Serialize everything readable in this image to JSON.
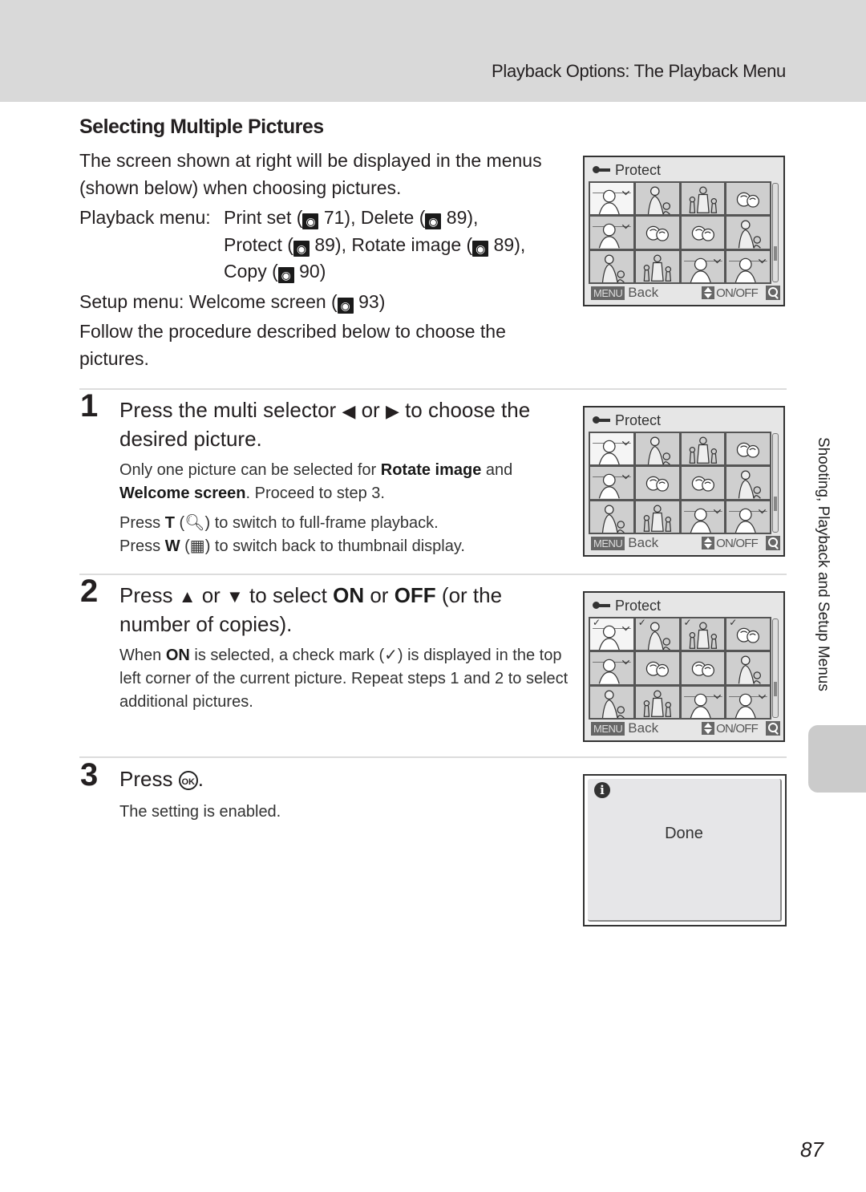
{
  "header": {
    "title": "Playback Options: The Playback Menu"
  },
  "section": {
    "title": "Selecting Multiple Pictures"
  },
  "intro": {
    "para1": "The screen shown at right will be displayed in the menus (shown below) when choosing pictures.",
    "playback_label": "Playback menu:",
    "playback_items": [
      {
        "name": "Print set (",
        "page": "71",
        "suffix": "), "
      },
      {
        "name": "Delete (",
        "page": "89",
        "suffix": "),"
      },
      {
        "name": "Protect (",
        "page": "89",
        "suffix": "), "
      },
      {
        "name": "Rotate image (",
        "page": "89",
        "suffix": "),"
      },
      {
        "name": "Copy (",
        "page": "90",
        "suffix": ")"
      }
    ],
    "setup_label": "Setup menu: Welcome screen (",
    "setup_page": "93",
    "setup_suffix": ")",
    "para_follow": "Follow the procedure described below to choose the pictures.",
    "ref_icon": "page-reference-icon"
  },
  "steps": [
    {
      "number": "1",
      "head_pre": "Press the multi selector ",
      "head_mid": " or ",
      "head_post": " to choose the desired picture.",
      "left_glyph": "◀",
      "right_glyph": "▶",
      "body1_pre": "Only one picture can be selected for ",
      "body1_b1": "Rotate image",
      "body1_mid": " and ",
      "body1_b2": "Welcome screen",
      "body1_post": ". Proceed to step 3.",
      "body2_pre": "Press ",
      "body2_key": "T",
      "body2_post": " to switch to full-frame playback.",
      "body3_pre": "Press ",
      "body3_key": "W",
      "body3_post": " to switch back to thumbnail display."
    },
    {
      "number": "2",
      "head_pre": "Press ",
      "up_glyph": "▲",
      "head_or": " or ",
      "down_glyph": "▼",
      "head_mid": " to select ",
      "on": "ON",
      "or2": " or ",
      "off": "OFF",
      "head_post": " (or the number of copies).",
      "body_pre": "When ",
      "body_on": "ON",
      "body_post": " is selected, a check mark (✓) is displayed in the top left corner of the current picture. Repeat steps 1 and 2 to select additional pictures."
    },
    {
      "number": "3",
      "head_pre": "Press ",
      "ok_glyph": "OK",
      "head_post": ".",
      "body": "The setting is enabled."
    }
  ],
  "camera_screens": [
    {
      "title": "Protect",
      "back": "Back",
      "menu": "MENU",
      "onoff": "ON/OFF",
      "checked": []
    },
    {
      "title": "Protect",
      "back": "Back",
      "menu": "MENU",
      "onoff": "ON/OFF",
      "checked": []
    },
    {
      "title": "Protect",
      "back": "Back",
      "menu": "MENU",
      "onoff": "ON/OFF",
      "checked": [
        0,
        1,
        2,
        3
      ]
    }
  ],
  "done_screen": {
    "text": "Done"
  },
  "side_tab": {
    "text": "Shooting, Playback and Setup Menus"
  },
  "page_number": "87"
}
